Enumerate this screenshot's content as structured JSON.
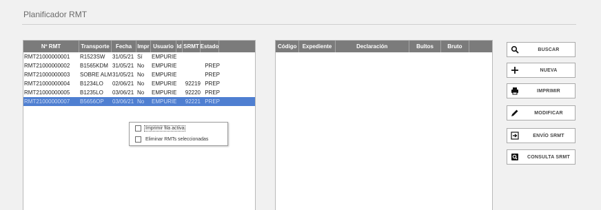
{
  "title": "Planificador RMT",
  "rmt_table": {
    "headers": [
      "Nº RMT",
      "Transporte",
      "Fecha",
      "Impr",
      "Usuario",
      "Id",
      "SRMT",
      "Estado"
    ],
    "rows": [
      [
        "RMT21000000001",
        "R1523SW",
        "31/05/21",
        "Sí",
        "EMPURIES",
        "",
        "",
        ""
      ],
      [
        "RMT21000000002",
        "B1565KDM",
        "31/05/21",
        "No",
        "EMPURIES",
        "",
        "",
        "PREP"
      ],
      [
        "RMT21000000003",
        "SOBRE ALMA",
        "31/05/21",
        "No",
        "EMPURIES",
        "",
        "",
        "PREP"
      ],
      [
        "RMT21000000004",
        "B1234LO",
        "02/06/21",
        "No",
        "EMPURIES",
        "",
        "92219",
        "PREP"
      ],
      [
        "RMT21000000005",
        "B1235LO",
        "03/06/21",
        "No",
        "EMPURIES",
        "",
        "92220",
        "PREP"
      ],
      [
        "RMT21000000007",
        "B5656OP",
        "03/06/21",
        "No",
        "EMPURIES",
        "",
        "92221",
        "PREP"
      ]
    ],
    "selected_row": 5
  },
  "detail_table": {
    "headers": [
      "Código",
      "Expediente",
      "Declaración",
      "Bultos",
      "Bruto"
    ]
  },
  "context_menu": {
    "items": [
      "Imprimir fila activa",
      "Eliminar RMTs seleccionadas"
    ]
  },
  "buttons": {
    "buscar": "BUSCAR",
    "nueva": "NUEVA",
    "imprimir": "IMPRIMIR",
    "modificar": "MODIFICAR",
    "envio": "ENVÍO SRMT",
    "consulta": "CONSULTA SRMT"
  },
  "icons": {
    "buscar": "search-icon",
    "nueva": "plus-icon",
    "imprimir": "printer-icon",
    "modificar": "pencil-icon",
    "envio": "send-icon",
    "consulta": "document-search-icon"
  },
  "colors": {
    "header_bg": "#7b7b7b",
    "selection": "#4f7fd1"
  }
}
